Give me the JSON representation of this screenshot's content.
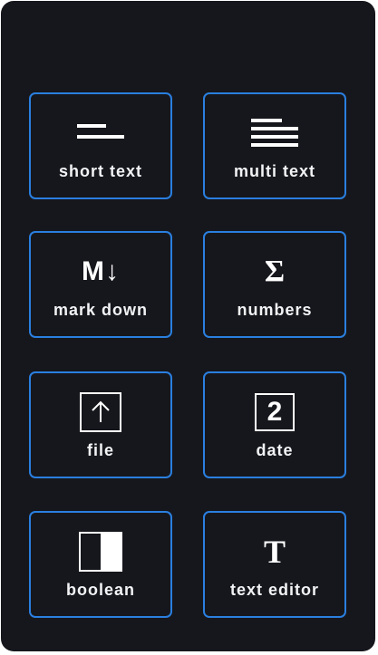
{
  "tiles": [
    {
      "label": "short text",
      "icon": "short-text-icon"
    },
    {
      "label": "multi text",
      "icon": "multi-text-icon"
    },
    {
      "label": "mark down",
      "icon": "markdown-icon",
      "glyph": "M↓"
    },
    {
      "label": "numbers",
      "icon": "sigma-icon",
      "glyph": "Σ"
    },
    {
      "label": "file",
      "icon": "upload-icon"
    },
    {
      "label": "date",
      "icon": "calendar-date-icon",
      "glyph": "2"
    },
    {
      "label": "boolean",
      "icon": "toggle-icon"
    },
    {
      "label": "text editor",
      "icon": "text-editor-icon",
      "glyph": "T"
    }
  ],
  "colors": {
    "panel_background": "#16171c",
    "tile_border": "#2a7fe0",
    "text": "#f2f3f5",
    "icon": "#ffffff"
  }
}
